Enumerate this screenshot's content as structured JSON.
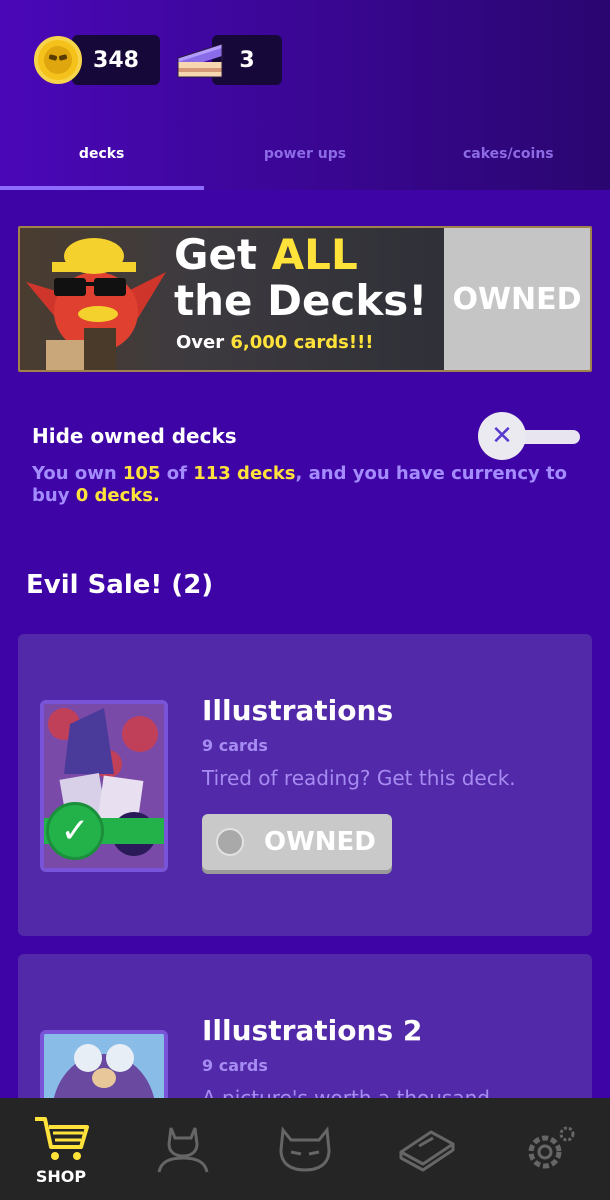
{
  "currency": {
    "coins": "348",
    "cakes": "3"
  },
  "tabs": [
    {
      "label": "decks",
      "active": true
    },
    {
      "label": "power ups",
      "active": false
    },
    {
      "label": "cakes/coins",
      "active": false
    }
  ],
  "banner": {
    "title_line1_a": "Get ",
    "title_line1_b": "ALL",
    "title_line2": "the Decks!",
    "sub_a": "Over ",
    "sub_b": "6,000 cards!!!",
    "status": "OWNED"
  },
  "filter": {
    "label": "Hide owned decks",
    "summary_a": "You own ",
    "owned_count": "105",
    "summary_b": " of ",
    "total_count": "113 decks",
    "summary_c": ", and you have currency to buy ",
    "buyable": "0 decks."
  },
  "section": {
    "title": "Evil Sale! (2)"
  },
  "decks": [
    {
      "name": "Illustrations",
      "count": "9 cards",
      "description": "Tired of reading? Get this deck.",
      "status": "OWNED"
    },
    {
      "name": "Illustrations 2",
      "count": "9 cards",
      "description": "A picture's worth a thousand"
    }
  ],
  "nav": {
    "shop_label": "SHOP"
  },
  "colors": {
    "accent": "#ffe23a",
    "background": "#3e04a6",
    "card": "#5229a8",
    "nav": "#252525",
    "success": "#23b14a"
  }
}
